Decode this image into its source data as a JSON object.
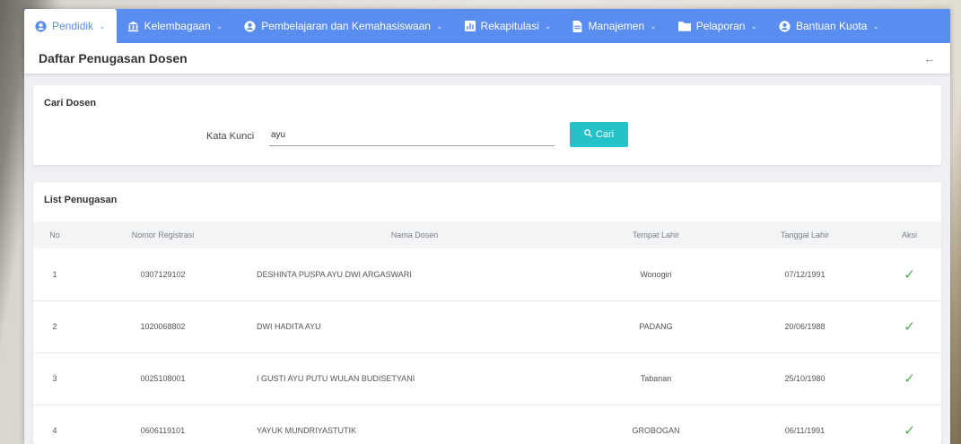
{
  "nav": {
    "items": [
      {
        "label": "Pendidik",
        "icon": "user-circle-icon",
        "active": true
      },
      {
        "label": "Kelembagaan",
        "icon": "institution-icon",
        "active": false
      },
      {
        "label": "Pembelajaran dan Kemahasiswaan",
        "icon": "user-circle-icon",
        "active": false
      },
      {
        "label": "Rekapitulasi",
        "icon": "bar-chart-icon",
        "active": false
      },
      {
        "label": "Manajemen",
        "icon": "file-icon",
        "active": false
      },
      {
        "label": "Pelaporan",
        "icon": "folder-icon",
        "active": false
      },
      {
        "label": "Bantuan Kuota",
        "icon": "user-circle-icon",
        "active": false
      }
    ],
    "color": "#5a8df0"
  },
  "page": {
    "title": "Daftar Penugasan Dosen",
    "back_icon": "arrow-left-icon"
  },
  "search": {
    "card_title": "Cari Dosen",
    "label": "Kata Kunci",
    "value": "ayu",
    "button_label": "Cari",
    "button_icon": "search-icon",
    "button_color": "#26c2c9"
  },
  "list": {
    "card_title": "List Penugasan",
    "columns": [
      "No",
      "Nomor Registrasi",
      "Nama Dosen",
      "Tempat Lahir",
      "Tanggal Lahir",
      "Aksi"
    ],
    "rows": [
      {
        "no": "1",
        "reg": "0307129102",
        "nama": "DESHINTA PUSPA AYU DWI ARGASWARI",
        "tempat": "Wonogiri",
        "tgl": "07/12/1991"
      },
      {
        "no": "2",
        "reg": "1020068802",
        "nama": "DWI HADITA AYU",
        "tempat": "PADANG",
        "tgl": "20/06/1988"
      },
      {
        "no": "3",
        "reg": "0025108001",
        "nama": "I GUSTI AYU PUTU WULAN BUDISETYANI",
        "tempat": "Tabanan",
        "tgl": "25/10/1980"
      },
      {
        "no": "4",
        "reg": "0606119101",
        "nama": "YAYUK MUNDRIYASTUTIK",
        "tempat": "GROBOGAN",
        "tgl": "06/11/1991"
      }
    ],
    "action_icon": "check-icon",
    "action_color": "#4caf50"
  }
}
